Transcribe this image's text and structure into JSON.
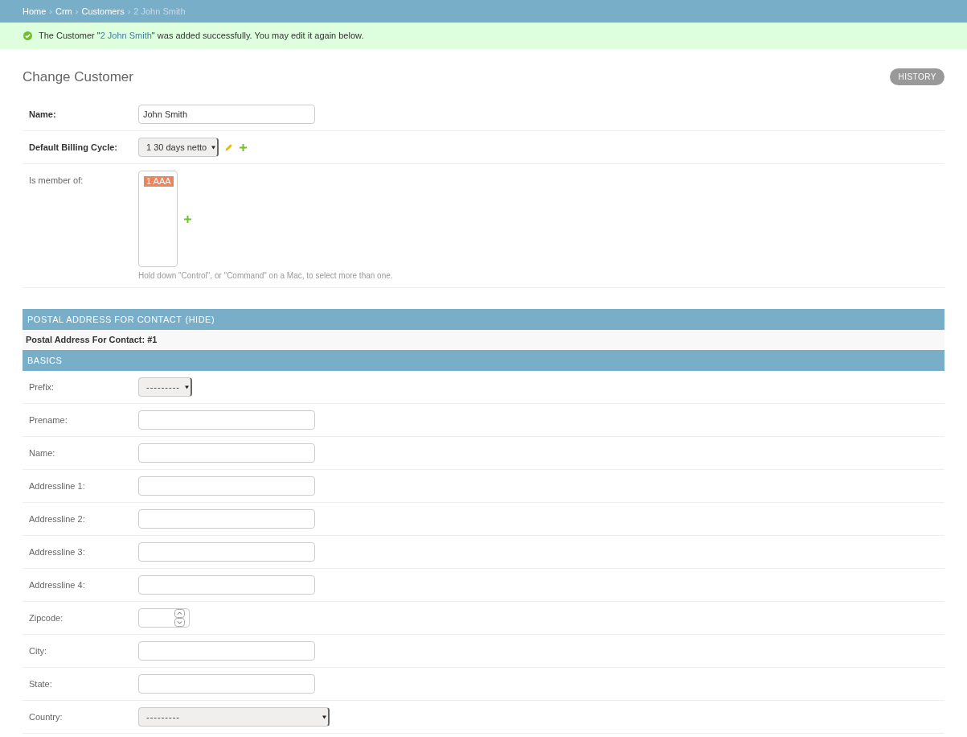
{
  "breadcrumbs": [
    {
      "label": "Home",
      "current": false
    },
    {
      "separator": "›",
      "label": "Crm",
      "current": false
    },
    {
      "separator": "›",
      "label": "Customers",
      "current": false
    },
    {
      "separator": "›",
      "label": "2 John Smith",
      "current": true
    }
  ],
  "message": {
    "kind": "success",
    "before": "The Customer \"",
    "link": "2 John Smith",
    "after": "\" was added successfully. You may edit it again below."
  },
  "title": "Change Customer",
  "history_button": "HISTORY",
  "fields": [
    {
      "kind": "text",
      "label": "Name:",
      "required": true,
      "value": "John Smith"
    },
    {
      "kind": "select",
      "label": "Default Billing Cycle:",
      "required": true,
      "value": "1 30 days netto",
      "edit_link": true,
      "add_link": true
    },
    {
      "kind": "multiselect",
      "label": "Is member of:",
      "required": false,
      "options": [
        {
          "label": "1 AAA",
          "selected": true
        }
      ],
      "add_link": true,
      "help": "Hold down \"Control\", or \"Command\" on a Mac, to select more than one."
    }
  ],
  "fieldset": {
    "title": "POSTAL ADDRESS FOR CONTACT",
    "toggle": "(HIDE)",
    "inline_title": "Postal Address For Contact: #1",
    "section": "BASICS",
    "fields": [
      {
        "kind": "select",
        "label": "Prefix:",
        "required": false,
        "value": "---------"
      },
      {
        "kind": "text",
        "label": "Prename:",
        "required": false
      },
      {
        "kind": "text",
        "label": "Name:",
        "required": false
      },
      {
        "kind": "text",
        "label": "Addressline 1:",
        "required": false
      },
      {
        "kind": "text",
        "label": "Addressline 2:",
        "required": false
      },
      {
        "kind": "text",
        "label": "Addressline 3:",
        "required": false
      },
      {
        "kind": "text",
        "label": "Addressline 4:",
        "required": false
      },
      {
        "kind": "number",
        "label": "Zipcode:",
        "required": false
      },
      {
        "kind": "text",
        "label": "City:",
        "required": false
      },
      {
        "kind": "text",
        "label": "State:",
        "required": false
      },
      {
        "kind": "wideselect",
        "label": "Country:",
        "required": false,
        "value": "---------"
      }
    ]
  }
}
